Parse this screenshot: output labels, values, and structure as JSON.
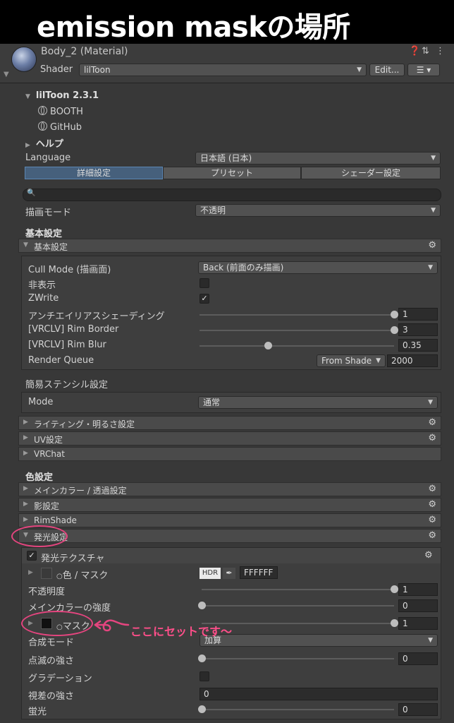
{
  "title": "emission maskの場所",
  "material": {
    "name": "Body_2 (Material)",
    "shader_label": "Shader",
    "shader_value": "lilToon",
    "edit_button": "Edit..."
  },
  "header": {
    "version": "lilToon 2.3.1",
    "links": [
      "BOOTH",
      "GitHub"
    ],
    "help": "ヘルプ"
  },
  "language": {
    "label": "Language",
    "value": "日本語 (日本)"
  },
  "tabs": [
    "詳細設定",
    "プリセット",
    "シェーダー設定"
  ],
  "render_mode": {
    "label": "描画モード",
    "value": "不透明"
  },
  "basic_heading": "基本設定",
  "basic_section": {
    "title": "基本設定",
    "cull_mode": {
      "label": "Cull Mode (描画面)",
      "value": "Back (前面のみ描画)"
    },
    "invisible": {
      "label": "非表示",
      "checked": false
    },
    "zwrite": {
      "label": "ZWrite",
      "checked": true
    },
    "antialias": {
      "label": "アンチエイリアスシェーディング",
      "value": "1",
      "level": 1.0
    },
    "rim_border": {
      "label": "[VRCLV] Rim Border",
      "value": "3",
      "level": 1.0
    },
    "rim_blur": {
      "label": "[VRCLV] Rim Blur",
      "value": "0.35",
      "level": 0.35
    },
    "render_queue": {
      "label": "Render Queue",
      "dropdown": "From Shade",
      "value": "2000"
    }
  },
  "stencil": {
    "heading": "簡易ステンシル設定",
    "mode_label": "Mode",
    "mode_value": "通常"
  },
  "sections_1": [
    "ライティング・明るさ設定",
    "UV設定",
    "VRChat"
  ],
  "color_heading": "色設定",
  "sections_2": [
    "メインカラー / 透過設定",
    "影設定",
    "RimShade",
    "発光設定"
  ],
  "emission": {
    "texture_toggle": "発光テクスチャ",
    "color_mask": {
      "label": "色 / マスク",
      "hdr": "HDR",
      "hex": "FFFFFF"
    },
    "opacity": {
      "label": "不透明度",
      "value": "1",
      "level": 1.0
    },
    "main_color_strength": {
      "label": "メインカラーの強度",
      "value": "0",
      "level": 0
    },
    "mask": {
      "label": "マスク",
      "value": "1",
      "level": 1.0
    },
    "blend_mode": {
      "label": "合成モード",
      "value": "加算"
    },
    "blink": {
      "label": "点滅の強さ",
      "value": "0",
      "level": 0
    },
    "gradation": {
      "label": "グラデーション",
      "checked": false
    },
    "parallax": {
      "label": "視差の強さ",
      "value": "0"
    },
    "fluorescence": {
      "label": "蛍光",
      "value": "0",
      "level": 0
    }
  },
  "annotation": "ここにセットです〜",
  "colors": {
    "annotation": "#e5457f",
    "active_tab": "#46607c"
  }
}
